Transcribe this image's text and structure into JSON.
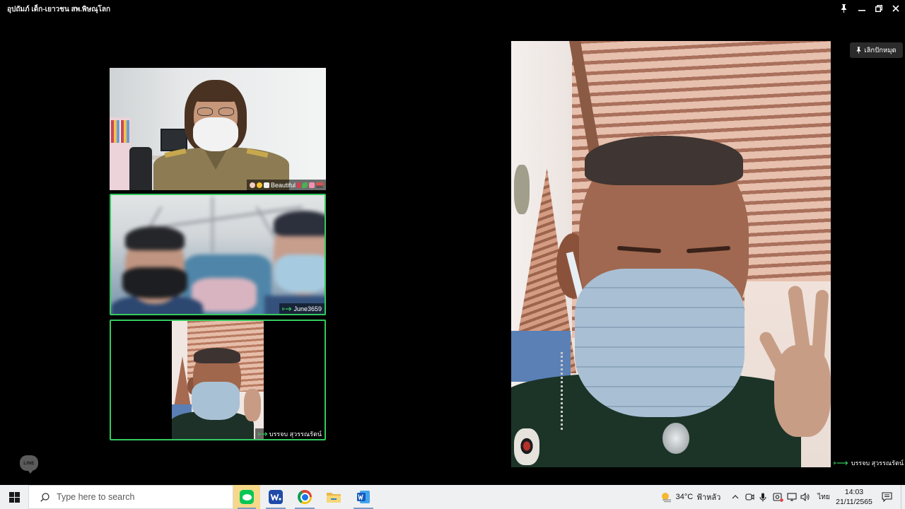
{
  "window": {
    "title": "อุปถัมภ์ เด็ก-เยาวชน สพ.พิษณุโลก",
    "background": "#000000",
    "controls": [
      "pin-icon",
      "minimize-icon",
      "restore-icon",
      "close-icon"
    ]
  },
  "call": {
    "unpin_label": "เลิกปักหมุด",
    "active_border_color": "#35c95f",
    "tiles": [
      {
        "name": "Beautiful",
        "active": false,
        "emoji_before": [
          "victory-hand-emoji",
          "face-emoji",
          "white-square-emoji"
        ],
        "emoji_after": [
          "red-ribbon-emoji",
          "green-leaf-emoji",
          "pink-gift-emoji",
          "car-emoji"
        ]
      },
      {
        "name": "June3659",
        "active": true,
        "icon": "speaking-indicator-icon"
      },
      {
        "name": "บรรจบ สุวรรณรัตน์",
        "active": true,
        "icon": "speaking-indicator-icon"
      }
    ],
    "main": {
      "name": "บรรจบ สุวรรณรัตน์",
      "icon": "speaking-indicator-icon"
    }
  },
  "line_logo_text": "LINE",
  "taskbar": {
    "start_icon": "windows-logo-icon",
    "search_placeholder": "Type here to search",
    "apps": [
      "line-app-icon",
      "blue-app-icon",
      "chrome-icon",
      "file-explorer-icon",
      "word-icon"
    ],
    "highlight_color": "#f5d88a",
    "weather": {
      "icon": "hazy-sun-icon",
      "temperature": "34°C",
      "condition": "ฟ้าหลัว"
    },
    "tray_icons": [
      "chevron-up-icon",
      "meet-now-icon",
      "microphone-icon",
      "webcam-icon",
      "network-icon",
      "speaker-icon"
    ],
    "language": "ไทย",
    "time": "14:03",
    "date": "21/11/2565",
    "notification_icon": "notification-center-icon"
  }
}
